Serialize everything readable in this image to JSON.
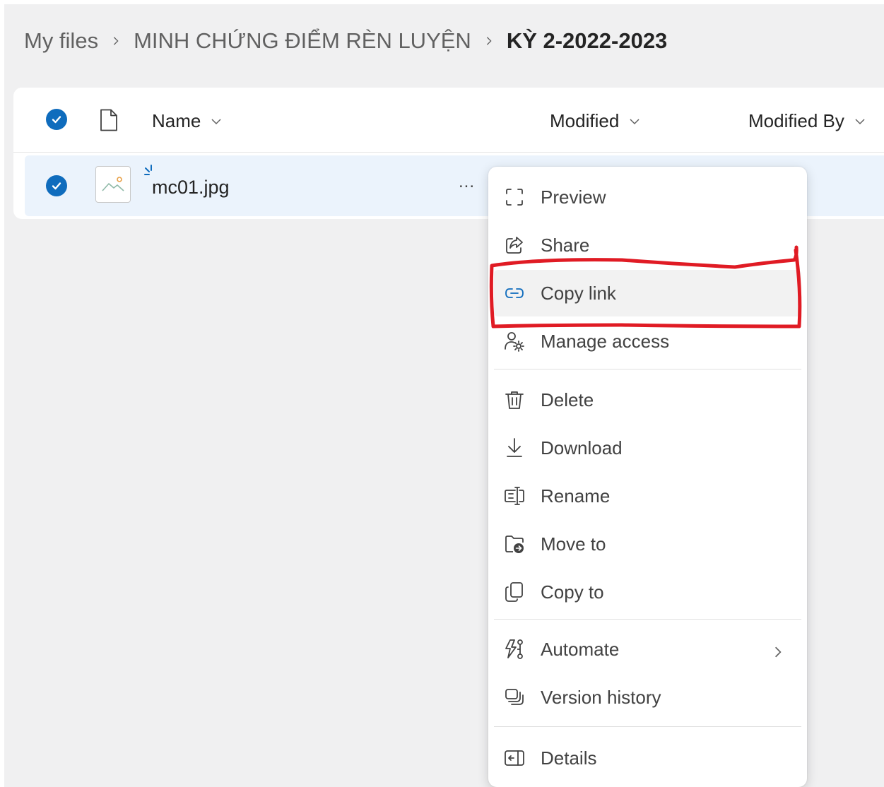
{
  "breadcrumb": {
    "items": [
      "My files",
      "MINH CHỨNG ĐIỂM RÈN LUYỆN",
      "KỲ 2-2022-2023"
    ]
  },
  "table": {
    "columns": {
      "name": "Name",
      "modified": "Modified",
      "modified_by": "Modified By"
    },
    "rows": [
      {
        "name": "mc01.jpg",
        "selected": true,
        "icon": "image-file-icon"
      }
    ],
    "more_label": "..."
  },
  "context_menu": {
    "items": [
      {
        "label": "Preview",
        "icon": "preview-icon"
      },
      {
        "label": "Share",
        "icon": "share-icon"
      },
      {
        "label": "Copy link",
        "icon": "link-icon",
        "highlighted": true
      },
      {
        "label": "Manage access",
        "icon": "manage-access-icon"
      },
      {
        "label": "Delete",
        "icon": "trash-icon"
      },
      {
        "label": "Download",
        "icon": "download-icon"
      },
      {
        "label": "Rename",
        "icon": "rename-icon"
      },
      {
        "label": "Move to",
        "icon": "move-to-icon"
      },
      {
        "label": "Copy to",
        "icon": "copy-to-icon"
      },
      {
        "label": "Automate",
        "icon": "automate-icon",
        "has_submenu": true
      },
      {
        "label": "Version history",
        "icon": "version-history-icon"
      },
      {
        "label": "Details",
        "icon": "details-icon"
      }
    ]
  },
  "colors": {
    "accent": "#0f6cbd",
    "row_selected": "#ebf3fc",
    "annotation_red": "#e01b24"
  }
}
